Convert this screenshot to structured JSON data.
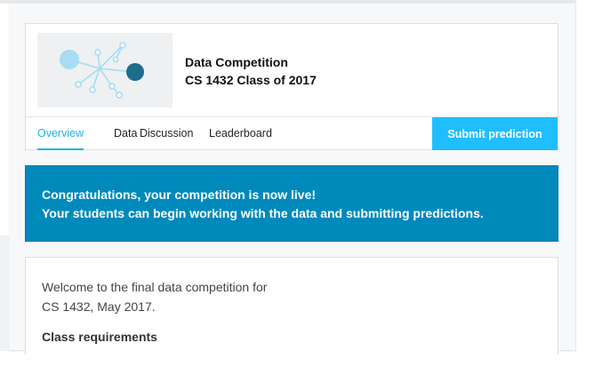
{
  "competition": {
    "title": "Data Competition",
    "subtitle": "CS 1432 Class of 2017",
    "thumbnail_icon": "network-graph-icon"
  },
  "nav": {
    "tabs": [
      {
        "label": "Overview",
        "active": true
      },
      {
        "label": "Data",
        "active": false
      },
      {
        "label": "Discussion",
        "active": false
      },
      {
        "label": "Leaderboard",
        "active": false
      }
    ],
    "submit_label": "Submit prediction"
  },
  "banner": {
    "line1": "Congratulations, your competition is now live!",
    "line2": "Your students can begin working with the data and submitting predictions."
  },
  "content": {
    "welcome_line1": "Welcome to the final data competition for",
    "welcome_line2": "CS 1432, May 2017.",
    "requirements_heading": "Class requirements"
  },
  "colors": {
    "accent": "#20beff",
    "active_tab": "#20b2e8",
    "banner": "#008abc",
    "node_light": "#a7dcf3",
    "node_dark": "#1c6e8c"
  }
}
